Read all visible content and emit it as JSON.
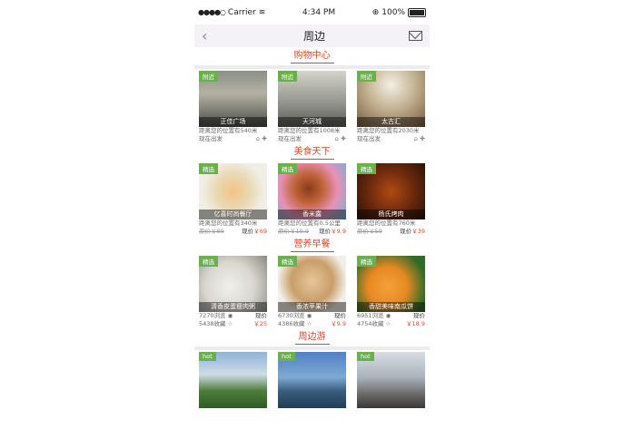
{
  "status": {
    "carrier": "Carrier",
    "time": "4:34 PM",
    "battery": "100%"
  },
  "nav": {
    "title": "周边",
    "back_icon": "chevron-left-icon",
    "mail_icon": "mail-icon"
  },
  "shopping": {
    "title": "购物中心",
    "items": [
      {
        "tag": "附近",
        "name": "正佳广场",
        "distance": "距离您的位置有540米",
        "depart": "现在出发"
      },
      {
        "tag": "附近",
        "name": "天河城",
        "distance": "距离您的位置有1008米",
        "depart": "现在出发"
      },
      {
        "tag": "附近",
        "name": "太古汇",
        "distance": "距离您的位置有2030米",
        "depart": "现在出发"
      }
    ]
  },
  "food": {
    "title": "美食天下",
    "items": [
      {
        "tag": "精选",
        "name": "亿喜时尚餐厅",
        "distance": "距离您的位置有340米",
        "orig": "原价￥89",
        "now_label": "现价",
        "now": "￥69"
      },
      {
        "tag": "精选",
        "name": "香米露",
        "distance": "距离您的位置有0.5公里",
        "orig": "原价￥19.9",
        "now_label": "现价",
        "now": "￥9.9"
      },
      {
        "tag": "精选",
        "name": "杨氏烤肉",
        "distance": "距离您的位置有760米",
        "orig": "原价￥59",
        "now_label": "现价",
        "now": "￥39"
      }
    ]
  },
  "breakfast": {
    "title": "营养早餐",
    "items": [
      {
        "tag": "精选",
        "name": "清香皮蛋瘦肉粥",
        "views": "7270浏览",
        "favs": "5438收藏",
        "now_label": "现价",
        "now": "￥25"
      },
      {
        "tag": "精选",
        "name": "香浓苹果汁",
        "views": "6730浏览",
        "favs": "4386收藏",
        "now_label": "现价",
        "now": "￥9.9"
      },
      {
        "tag": "精选",
        "name": "香甜美味南瓜饼",
        "views": "6951浏览",
        "favs": "4754收藏",
        "now_label": "现价",
        "now": "￥18.9"
      }
    ]
  },
  "tour": {
    "title": "周边游",
    "items": [
      {
        "tag": "hot"
      },
      {
        "tag": "hot"
      },
      {
        "tag": "hot"
      }
    ]
  }
}
